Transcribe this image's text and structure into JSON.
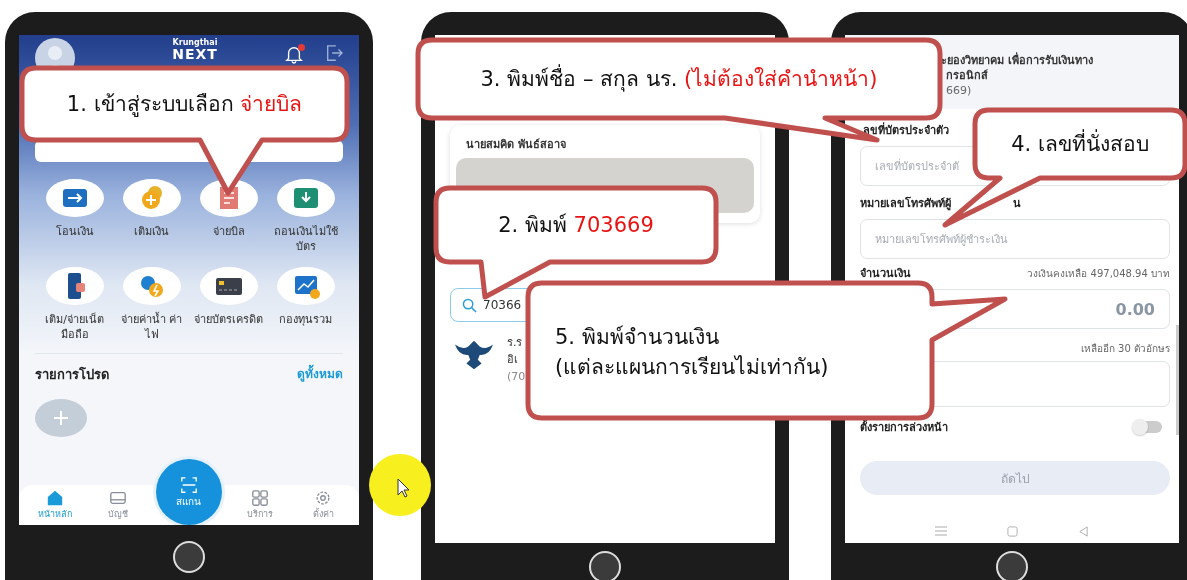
{
  "phone_home": {
    "brand": "Krungthai",
    "logo": "NEXT",
    "has_notification": true,
    "menu": [
      {
        "label": "โอนเงิน",
        "kind": "transfer"
      },
      {
        "label": "เติมเงิน",
        "kind": "topup"
      },
      {
        "label": "จ่ายบิล",
        "kind": "bill"
      },
      {
        "label": "ถอนเงินไม่ใช้บัตร",
        "kind": "cardless"
      },
      {
        "label": "เติม/จ่ายเน็ต มือถือ",
        "kind": "mobile"
      },
      {
        "label": "จ่ายค่าน้ำ ค่าไฟ",
        "kind": "utility"
      },
      {
        "label": "จ่ายบัตรเครดิต",
        "kind": "card"
      },
      {
        "label": "กองทุนรวม",
        "kind": "fund"
      }
    ],
    "favorites_title": "รายการโปรด",
    "see_all": "ดูทั้งหมด",
    "nav": [
      {
        "label": "หน้าหลัก",
        "kind": "home",
        "selected": true
      },
      {
        "label": "บัญชี",
        "kind": "account",
        "selected": false
      },
      {
        "label": "สแกน",
        "kind": "scan",
        "selected": false
      },
      {
        "label": "บริการ",
        "kind": "services",
        "selected": false
      },
      {
        "label": "ตั้งค่า",
        "kind": "settings",
        "selected": false
      }
    ]
  },
  "phone_search": {
    "card_name": "นายสมคิด พันธ์สอาจ",
    "search_value": "70366",
    "result_lines": [
      "ร.ร",
      "อิเ",
      "(70"
    ]
  },
  "phone_form": {
    "header_lines": [
      "ะยองวิทยาคม เพื่อการรับเงินทาง",
      "กรอนิกส์",
      "669)"
    ],
    "id_label": "ลขที่บัตรประจำตัว",
    "id_placeholder": "เลขที่บัตรประจำตั",
    "phone_label": "หมายเลขโทรศัพท์ผู้",
    "phone_label_end": "น",
    "phone_placeholder": "หมายเลขโทรศัพท์ผู้ชำระเงิน",
    "amount_label": "จำนวนเงิน",
    "balance": "วงเงินคงเหลือ 497,048.94 บาท",
    "amount_value": "0.00",
    "remaining": "เหลืออีก 30 ตัวอักษร",
    "schedule_label": "ตั้งรายการล่วงหน้า",
    "schedule_on": false,
    "next_button": {
      "label": "ถัดไป",
      "disabled": true
    }
  },
  "callouts": [
    {
      "text": "1. เข้าสู่ระบบเลือก",
      "highlight": "จ่ายบิล"
    },
    {
      "text": "3. พิมพ์ชื่อ – สกุล นร.",
      "highlight": "(ไม่ต้องใส่คำนำหน้า)"
    },
    {
      "text": "2. พิมพ์",
      "highlight": "703669"
    },
    {
      "text": "4. เลขที่นั่งสอบ"
    },
    {
      "text": "5. พิมพ์จำนวนเงิน",
      "line2": "(แต่ละแผนการเรียนไม่เท่ากัน)"
    }
  ]
}
